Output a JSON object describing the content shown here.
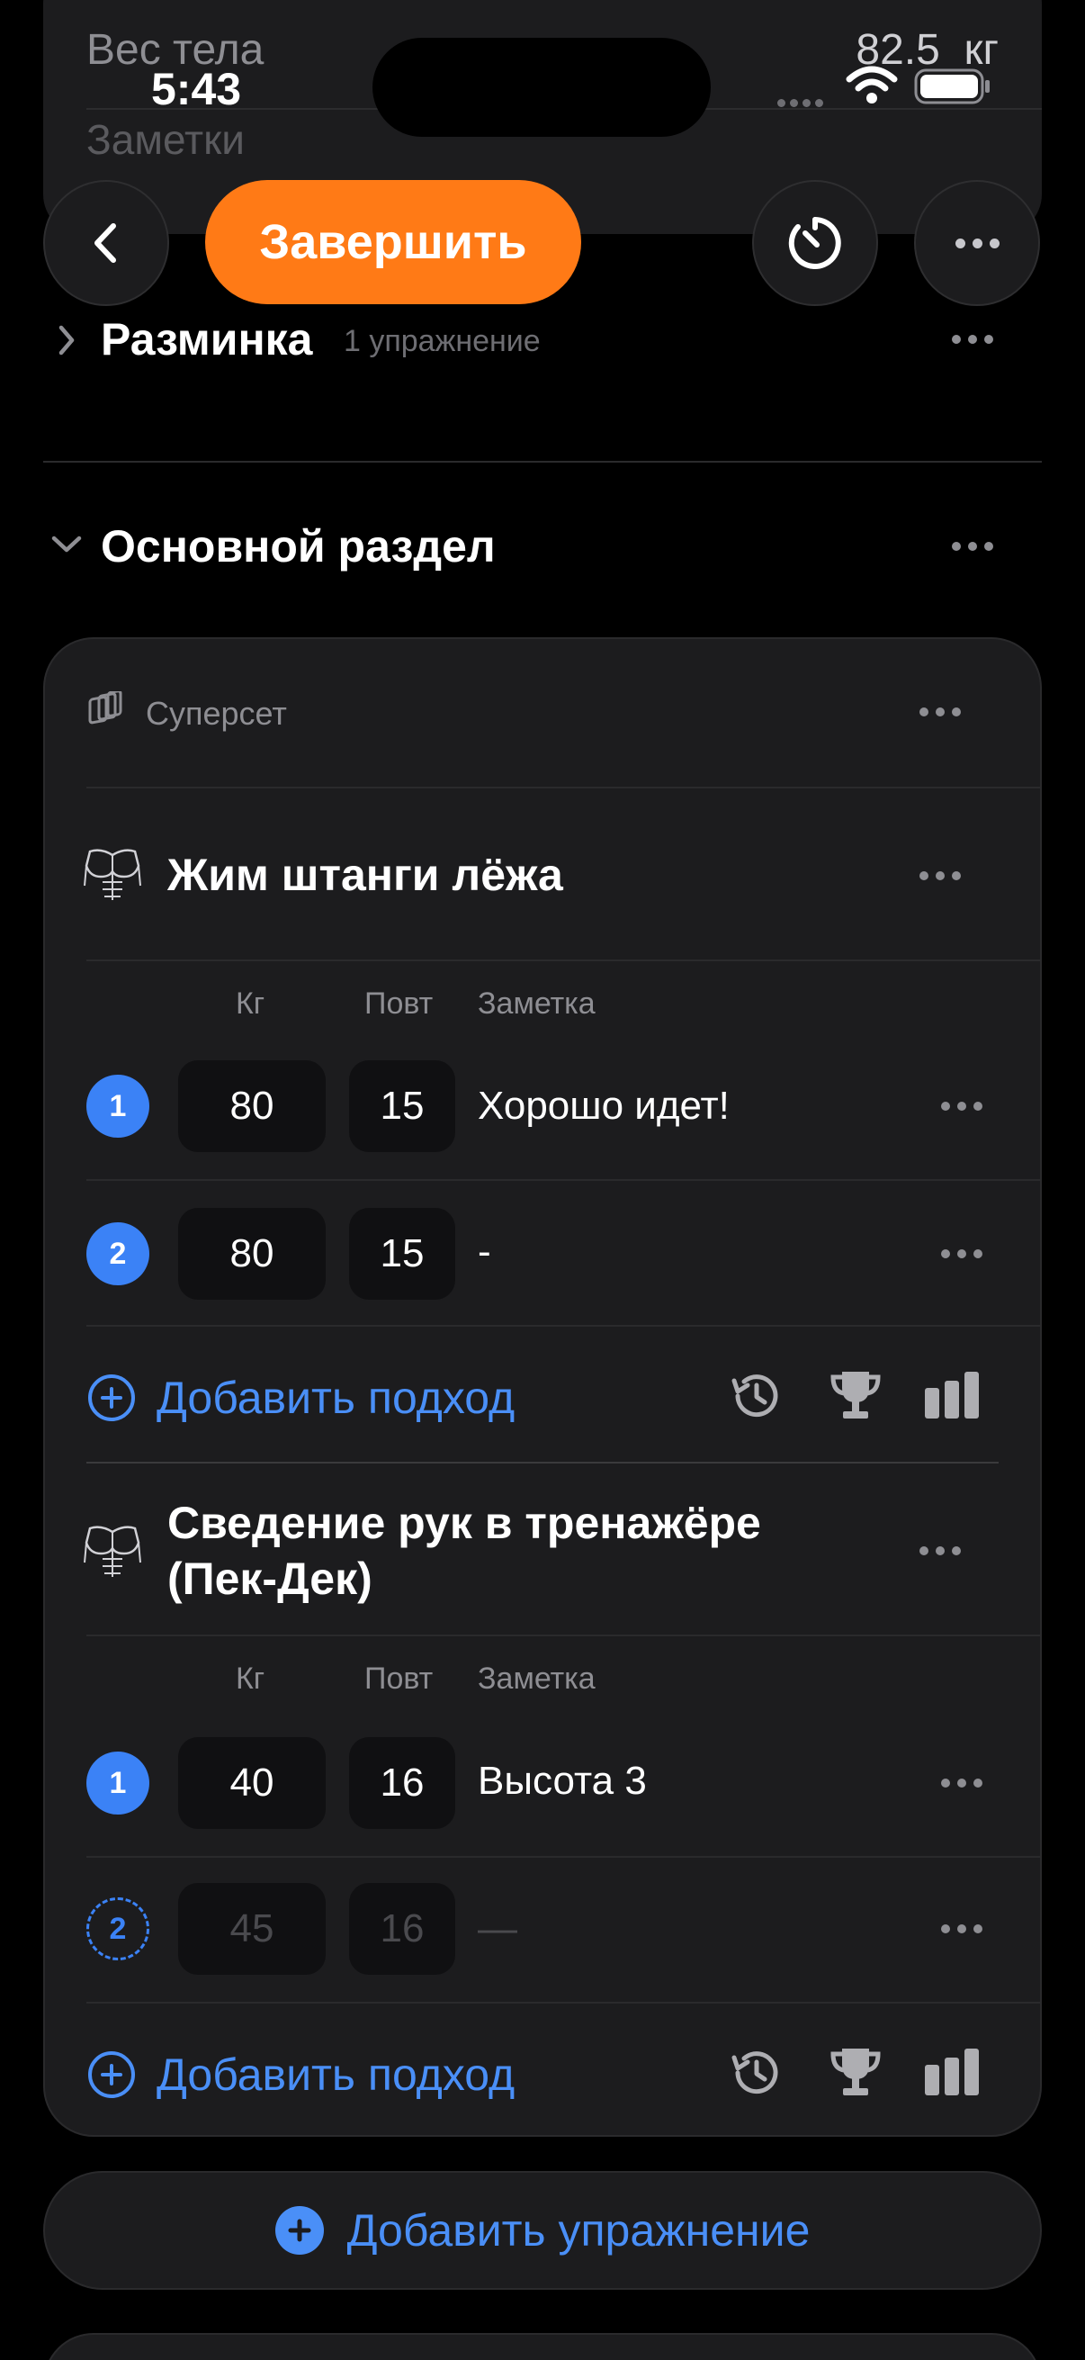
{
  "status_bar": {
    "time": "5:43"
  },
  "body_weight": {
    "label": "Вес тела",
    "value": "82.5",
    "unit": "кг",
    "notes_placeholder": "Заметки"
  },
  "header": {
    "finish_label": "Завершить"
  },
  "warmup": {
    "title": "Разминка",
    "count": "1 упражнение"
  },
  "main_section": {
    "title": "Основной раздел"
  },
  "superset": {
    "label": "Суперсет"
  },
  "columns": {
    "kg": "Кг",
    "reps": "Повт",
    "note": "Заметка"
  },
  "exercises": [
    {
      "title": "Жим штанги лёжа",
      "sets": [
        {
          "num": "1",
          "kg": "80",
          "reps": "15",
          "note": "Хорошо идет!"
        },
        {
          "num": "2",
          "kg": "80",
          "reps": "15",
          "note": "-"
        }
      ],
      "add_set": "Добавить подход"
    },
    {
      "title_line1": "Сведение рук в тренажёре",
      "title_line2": "(Пек-Дек)",
      "sets": [
        {
          "num": "1",
          "kg": "40",
          "reps": "16",
          "note": "Высота 3"
        },
        {
          "num": "2",
          "kg": "45",
          "reps": "16",
          "note": "—"
        }
      ],
      "add_set": "Добавить подход"
    }
  ],
  "add_exercise": "Добавить упражнение",
  "colors": {
    "accent_orange": "#ff7a16",
    "accent_blue": "#4a8ff7",
    "set_blue": "#3b82f6",
    "card_bg": "#1c1c1e"
  }
}
